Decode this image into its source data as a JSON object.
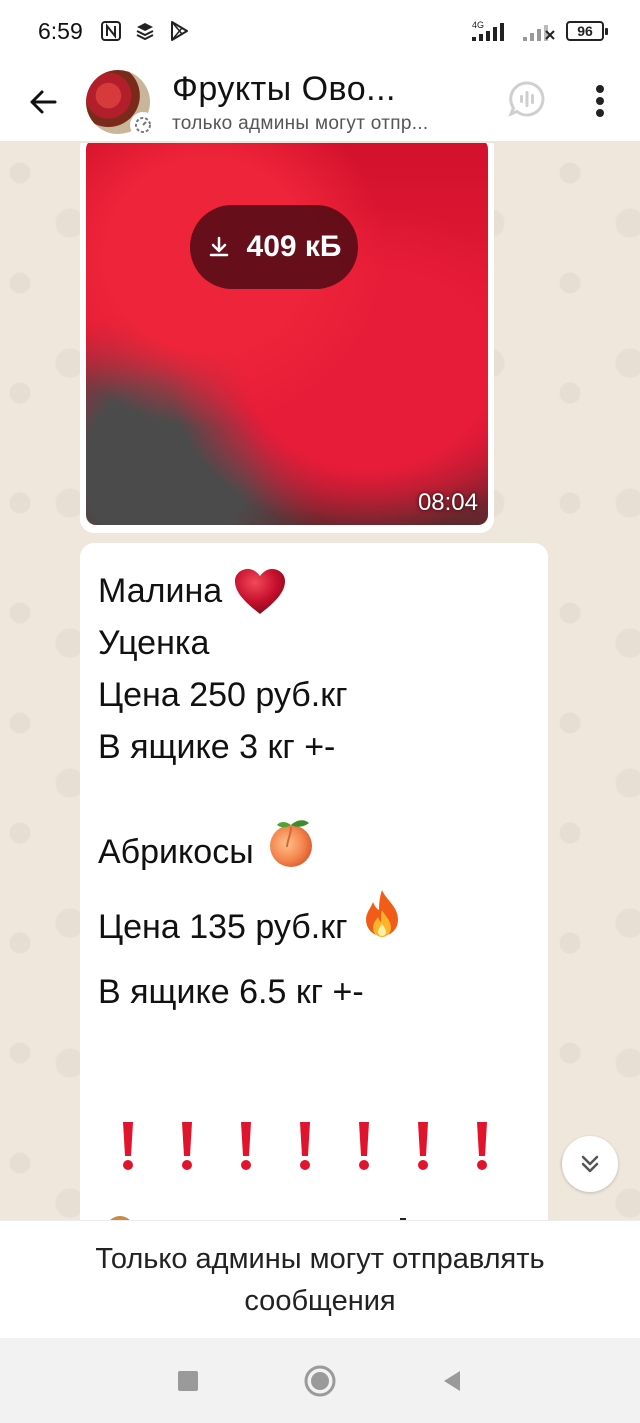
{
  "status_bar": {
    "time": "6:59",
    "network_label": "4G",
    "battery": "96"
  },
  "header": {
    "title": "Фрукты  Ово...",
    "subtitle": "только админы могут отпр..."
  },
  "video_message": {
    "download_size": "409 кБ",
    "time": "08:04"
  },
  "text_message": {
    "lines": {
      "l1": "Малина",
      "l2": "Уценка",
      "l3": "Цена 250 руб.кг",
      "l4": "В ящике 3 кг +-",
      "l5": "Абрикосы",
      "l6": "Цена 135 руб.кг",
      "l7": "В ящике 6.5 кг +-"
    },
    "exclamation_count": 7
  },
  "footer": {
    "notice": "Только админы могут отправлять сообщения"
  },
  "colors": {
    "accent_red": "#e0142c",
    "bubble": "#ffffff",
    "chat_background": "#efe7dc"
  }
}
